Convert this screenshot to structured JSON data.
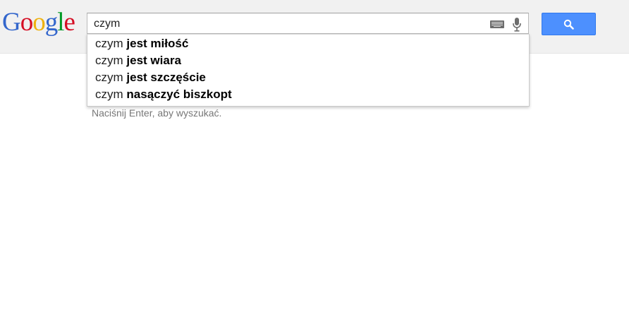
{
  "logo": {
    "letters": [
      {
        "char": "G",
        "color": "#3366cc"
      },
      {
        "char": "o",
        "color": "#d50f25"
      },
      {
        "char": "o",
        "color": "#eeb211"
      },
      {
        "char": "g",
        "color": "#3366cc"
      },
      {
        "char": "l",
        "color": "#009925"
      },
      {
        "char": "e",
        "color": "#d50f25"
      }
    ]
  },
  "search": {
    "value": "czym",
    "icons": [
      "keyboard-icon",
      "microphone-icon"
    ]
  },
  "search_button": {
    "icon": "magnifier-icon",
    "color": "#4d90fe"
  },
  "suggestions": [
    {
      "prefix": "czym",
      "completion": "jest miłość"
    },
    {
      "prefix": "czym",
      "completion": "jest wiara"
    },
    {
      "prefix": "czym",
      "completion": "jest szczęście"
    },
    {
      "prefix": "czym",
      "completion": "nasączyć biszkopt"
    }
  ],
  "hint": "Naciśnij Enter, aby wyszukać."
}
